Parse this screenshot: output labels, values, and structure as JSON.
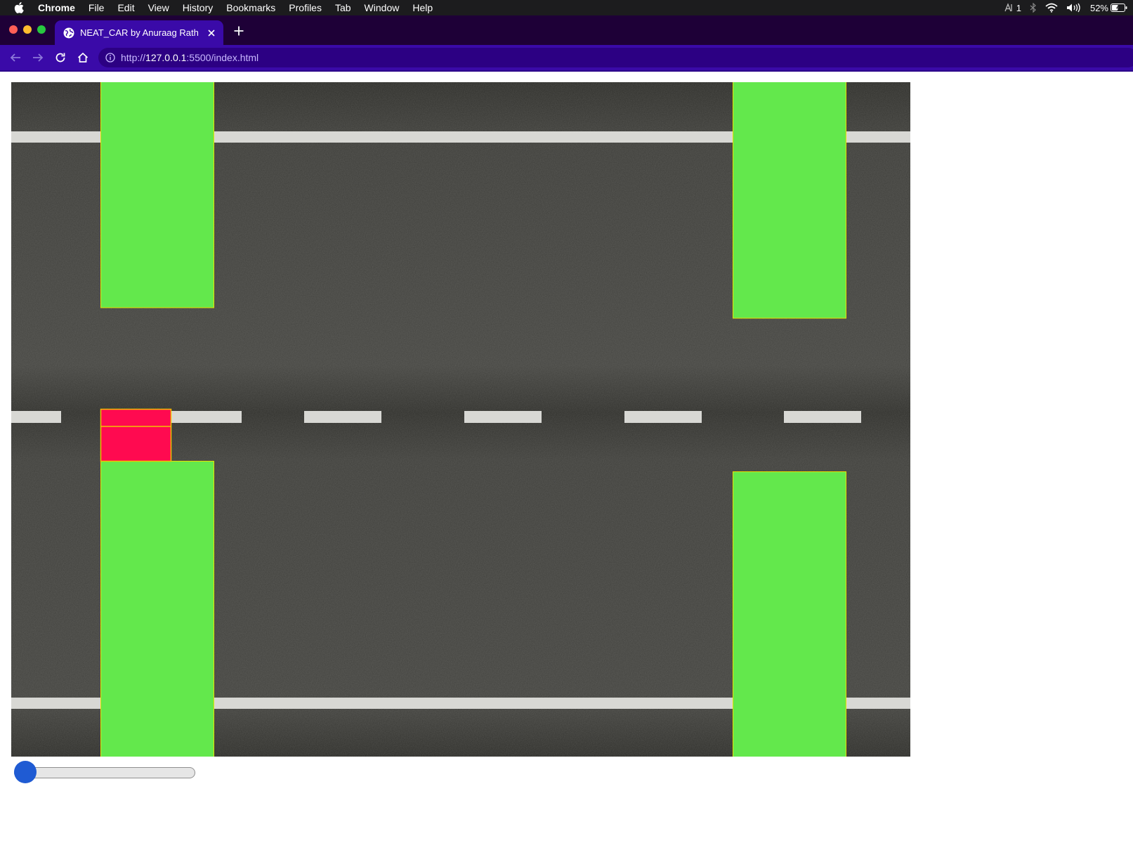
{
  "menubar": {
    "app_name": "Chrome",
    "items": [
      "File",
      "Edit",
      "View",
      "History",
      "Bookmarks",
      "Profiles",
      "Tab",
      "Window",
      "Help"
    ],
    "status": {
      "input_indicator": "1",
      "battery": "52%"
    }
  },
  "browser": {
    "tab_title": "NEAT_CAR by Anuraag Rath",
    "url_scheme": "http://",
    "url_host": "127.0.0.1",
    "url_path": ":5500/index.html"
  },
  "colors": {
    "road": "#3a3a36",
    "lane_marking": "#d8d8d4",
    "obstacle": "#63e84c",
    "obstacle_border": "#e8e000",
    "car": "#ff0a50",
    "car_border": "#f2c200"
  },
  "slider": {
    "value": 0
  }
}
